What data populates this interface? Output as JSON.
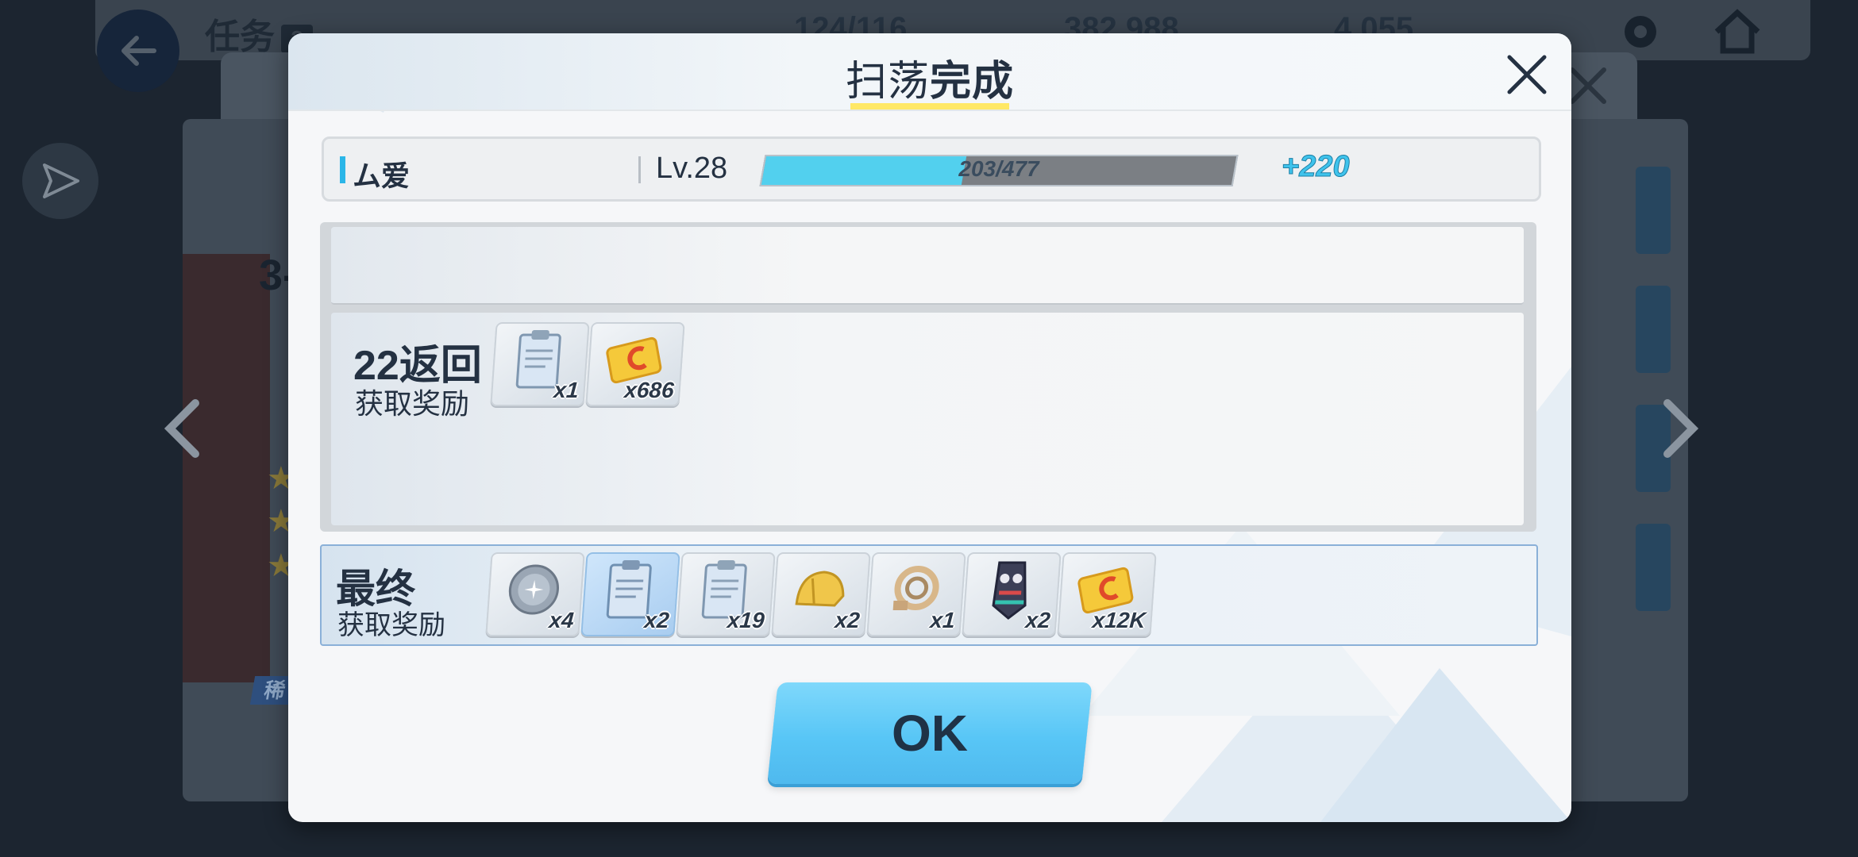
{
  "background": {
    "title": "任务",
    "title_badge": "2",
    "resources": [
      "124/116",
      "382,988",
      "4,055"
    ],
    "stage_label": "3-",
    "tag_label": "稀"
  },
  "modal": {
    "title_light": "扫荡",
    "title_bold": "完成",
    "character": {
      "name": "ム爱",
      "level": "Lv.28",
      "exp_text": "203/477",
      "exp_current": 203,
      "exp_max": 477,
      "exp_gain": "+220"
    },
    "rows": [
      {
        "title": "22返回",
        "subtitle": "获取奖励",
        "items": [
          {
            "icon": "report-icon",
            "qty": "x1"
          },
          {
            "icon": "credit-card-icon",
            "qty": "x686"
          }
        ]
      }
    ],
    "final": {
      "title": "最终",
      "subtitle": "获取奖励",
      "items": [
        {
          "icon": "silver-orb-icon",
          "qty": "x4"
        },
        {
          "icon": "report-icon",
          "qty": "x2"
        },
        {
          "icon": "report-icon",
          "qty": "x19"
        },
        {
          "icon": "gold-helmet-icon",
          "qty": "x2"
        },
        {
          "icon": "ring-artifact-icon",
          "qty": "x1"
        },
        {
          "icon": "mask-artifact-icon",
          "qty": "x2"
        },
        {
          "icon": "credit-card-icon",
          "qty": "x12K"
        }
      ]
    },
    "ok_label": "OK"
  },
  "colors": {
    "accent": "#52d0ee",
    "title_underline": "#ffe866",
    "ok_button": "#58c6f6"
  }
}
